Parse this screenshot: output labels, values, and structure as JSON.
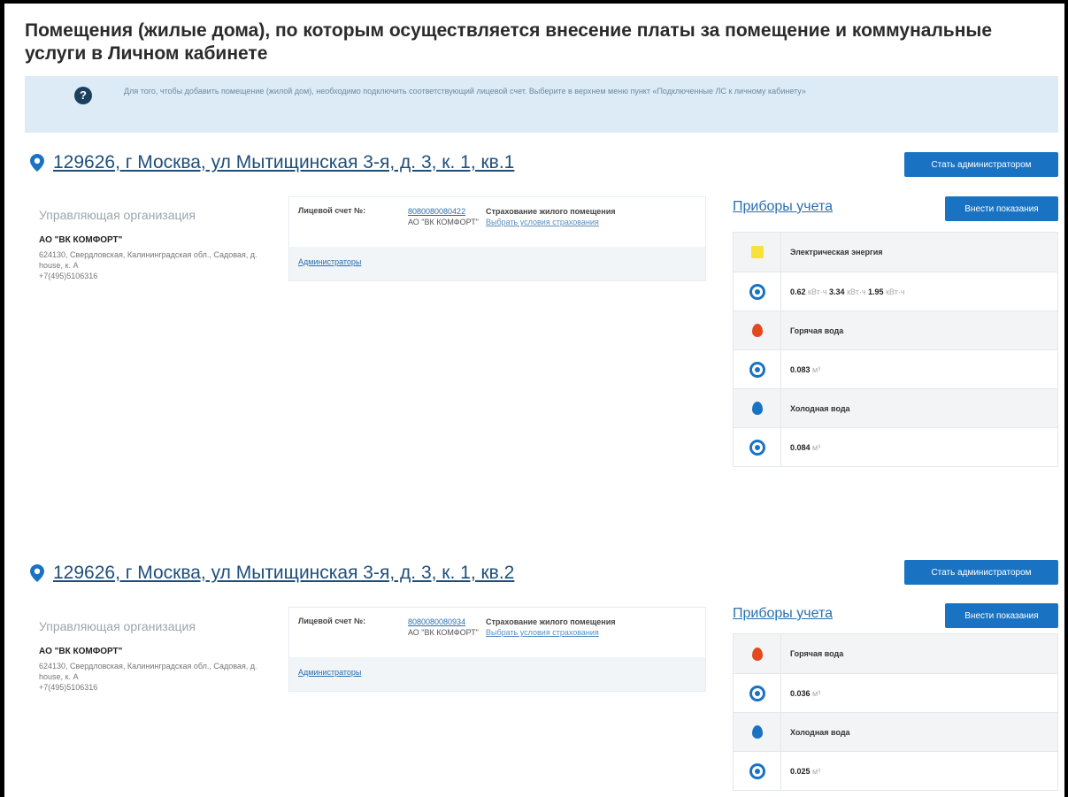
{
  "page": {
    "title": "Помещения (жилые дома), по которым осуществляется внесение платы за помещение и коммунальные услуги в Личном кабинете",
    "info_text": "Для того, чтобы добавить помещение (жилой дом), необходимо подключить соответствующий лицевой счет. Выберите в верхнем меню пункт «Подключенные ЛС к личному кабинету»"
  },
  "properties": [
    {
      "address": "129626, г Москва, ул Мытищинская 3-я, д. 3, к. 1, кв.1",
      "admin_button": "Стать администратором",
      "org_label": "Управляющая организация",
      "org_name": "АО \"ВК КОМФОРТ\"",
      "org_address": "624130, Свердловская, Калининградская обл., Садовая, д. house, к. А",
      "org_phone": "+7(495)5106316",
      "account_label": "Лицевой счет №:",
      "account_number": "8080080080422",
      "account_org": "АО \"ВК КОМФОРТ\"",
      "insurance_label": "Страхование жилого помещения",
      "insurance_link": "Выбрать условия страхования",
      "admins_link": "Администраторы",
      "meters_title": "Приборы учета",
      "readings_button": "Внести показания",
      "meters": [
        {
          "name": "Электрическая энергия",
          "v1": "0.62",
          "u1": "кВт·ч",
          "v2": "3.34",
          "u2": "кВт·ч",
          "v3": "1.95",
          "u3": "кВт·ч"
        },
        {
          "name": "Горячая вода",
          "value": "0.083",
          "unit": "м³"
        },
        {
          "name": "Холодная вода",
          "value": "0.084",
          "unit": "м³"
        }
      ]
    },
    {
      "address": "129626, г Москва, ул Мытищинская 3-я, д. 3, к. 1, кв.2",
      "admin_button": "Стать администратором",
      "org_label": "Управляющая организация",
      "org_name": "АО \"ВК КОМФОРТ\"",
      "org_address": "624130, Свердловская, Калининградская обл., Садовая, д. house, к. А",
      "org_phone": "+7(495)5106316",
      "account_label": "Лицевой счет №:",
      "account_number": "8080080080934",
      "account_org": "АО \"ВК КОМФОРТ\"",
      "insurance_label": "Страхование жилого помещения",
      "insurance_link": "Выбрать условия страхования",
      "admins_link": "Администраторы",
      "meters_title": "Приборы учета",
      "readings_button": "Внести показания",
      "meters": [
        {
          "name": "Горячая вода",
          "value": "0.036",
          "unit": "м³"
        },
        {
          "name": "Холодная вода",
          "value": "0.025",
          "unit": "м³"
        }
      ]
    }
  ],
  "colors": {
    "accent": "#1a73c2",
    "info_bg": "#dcebf5",
    "link": "#2b6fb0"
  }
}
